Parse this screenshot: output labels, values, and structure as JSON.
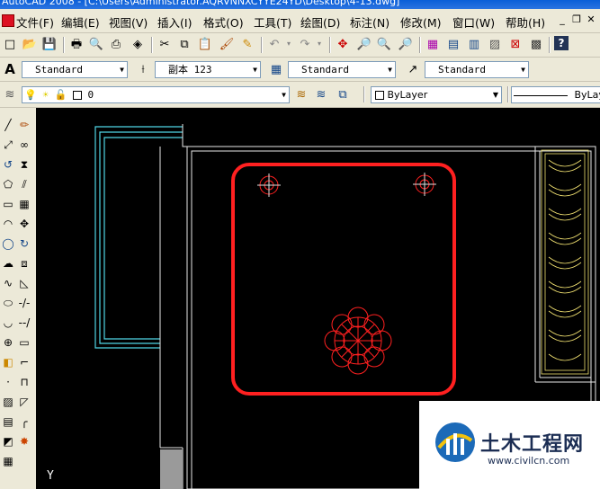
{
  "window": {
    "title": "AutoCAD 2008 - [C:\\Users\\Administrator.AQRVNNXCYYE24YD\\Desktop\\4-13.dwg]"
  },
  "menu": {
    "items": [
      {
        "label": "文件(F)"
      },
      {
        "label": "编辑(E)"
      },
      {
        "label": "视图(V)"
      },
      {
        "label": "插入(I)"
      },
      {
        "label": "格式(O)"
      },
      {
        "label": "工具(T)"
      },
      {
        "label": "绘图(D)"
      },
      {
        "label": "标注(N)"
      },
      {
        "label": "修改(M)"
      },
      {
        "label": "窗口(W)"
      },
      {
        "label": "帮助(H)"
      }
    ]
  },
  "styles": {
    "text_style": "Standard",
    "dim_style": "副本 123",
    "table_style": "Standard",
    "multileader_style": "Standard"
  },
  "layers": {
    "current_layer": "0",
    "color": "ByLayer",
    "linetype": "ByLay"
  },
  "canvas": {
    "axis_label": "Y"
  },
  "watermark": {
    "title": "土木工程网",
    "url": "www.civilcn.com"
  },
  "colors": {
    "canvas_bg": "#000000",
    "part_outline": "#ff2020",
    "wall_lines": "#4fd6e6",
    "frame_lines": "#ffffff",
    "detail_lines": "#f0e070"
  }
}
